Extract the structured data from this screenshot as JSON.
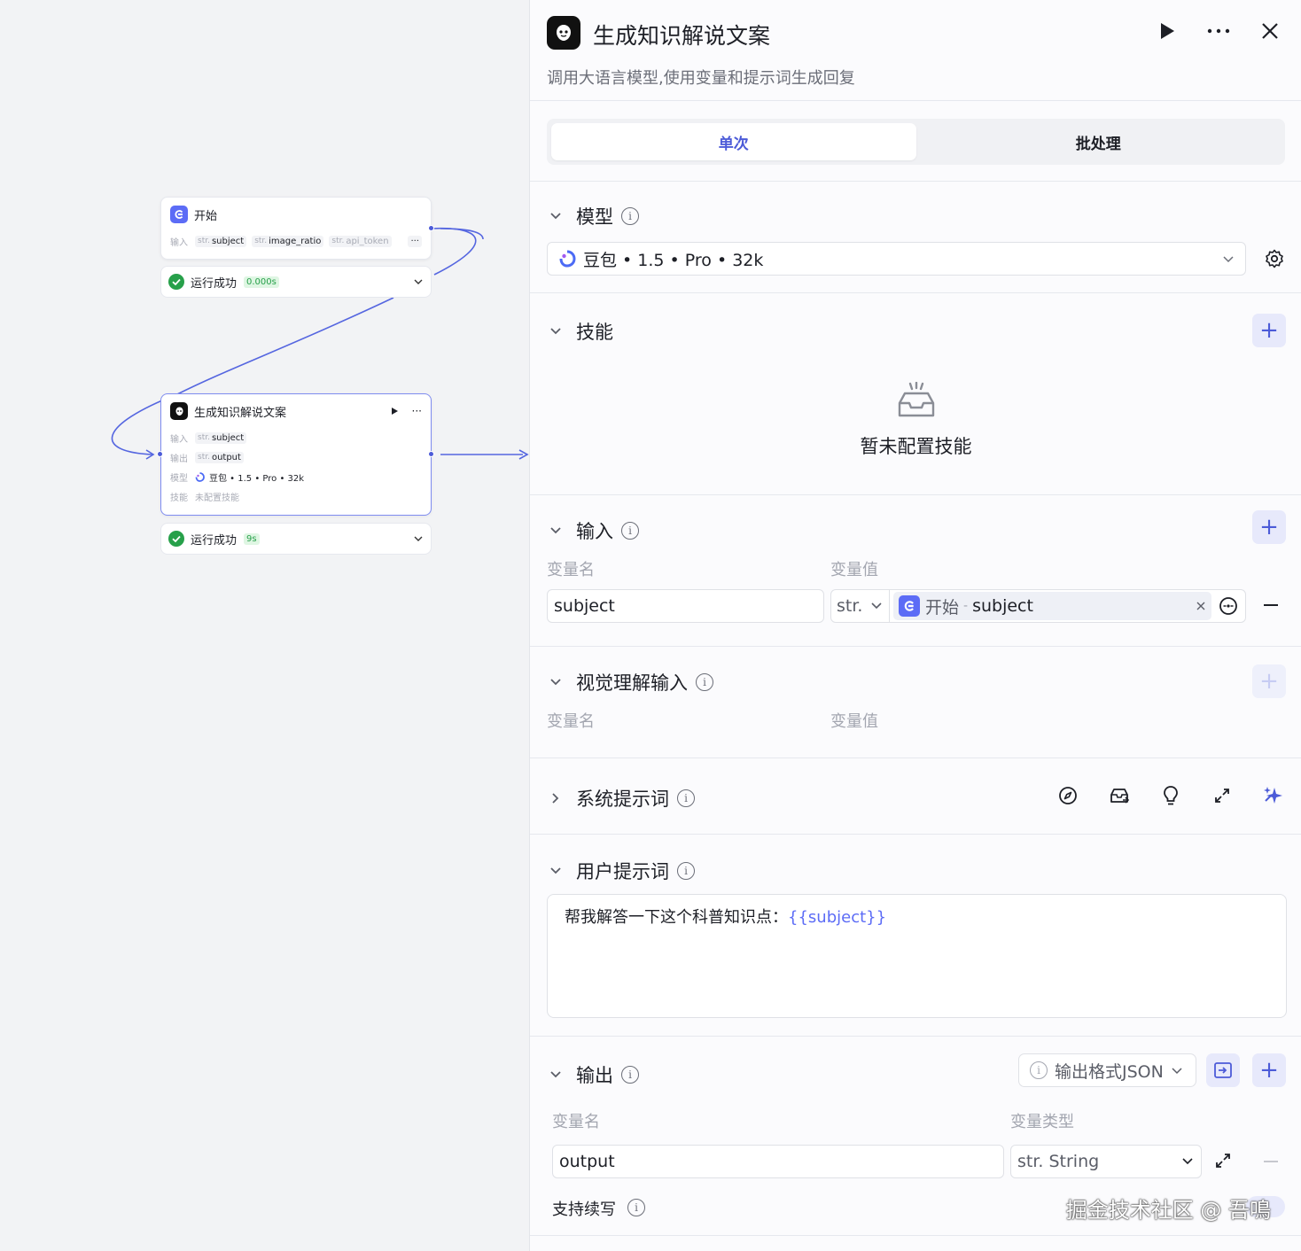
{
  "canvas": {
    "start_node": {
      "title": "开始",
      "input_label": "输入",
      "inputs": [
        {
          "type": "str.",
          "name": "subject"
        },
        {
          "type": "str.",
          "name": "image_ratio"
        },
        {
          "type": "str.",
          "name": "api_token"
        }
      ],
      "more": "···",
      "status": "运行成功",
      "time": "0.000s"
    },
    "llm_node": {
      "title": "生成知识解说文案",
      "more": "···",
      "input_label": "输入",
      "input_chip": {
        "type": "str.",
        "name": "subject"
      },
      "output_label": "输出",
      "output_chip": {
        "type": "str.",
        "name": "output"
      },
      "model_label": "模型",
      "model_value": "豆包 • 1.5 • Pro • 32k",
      "skill_label": "技能",
      "skill_value": "未配置技能",
      "status": "运行成功",
      "time": "9s"
    }
  },
  "panel": {
    "title": "生成知识解说文案",
    "description": "调用大语言模型,使用变量和提示词生成回复",
    "tabs": [
      {
        "label": "单次",
        "active": true
      },
      {
        "label": "批处理",
        "active": false
      }
    ],
    "model": {
      "title": "模型",
      "value": "豆包 • 1.5 • Pro • 32k"
    },
    "skills": {
      "title": "技能",
      "empty_text": "暂未配置技能"
    },
    "input": {
      "title": "输入",
      "col_name": "变量名",
      "col_value": "变量值",
      "row": {
        "name": "subject",
        "type": "str.",
        "ref_node": "开始",
        "ref_sep": "-",
        "ref_var": "subject"
      }
    },
    "vision_input": {
      "title": "视觉理解输入",
      "col_name": "变量名",
      "col_value": "变量值"
    },
    "system_prompt": {
      "title": "系统提示词"
    },
    "user_prompt": {
      "title": "用户提示词",
      "text": "帮我解答一下这个科普知识点：",
      "variable": "{{subject}}"
    },
    "output": {
      "title": "输出",
      "format_label": "输出格式JSON",
      "col_name": "变量名",
      "col_type": "变量类型",
      "row": {
        "name": "output",
        "type_prefix": "str.",
        "type": "String"
      },
      "streaming_label": "支持续写"
    },
    "watermark": "掘金技术社区 @ 吾鳴"
  },
  "colors": {
    "accent": "#4c5bd8",
    "success": "#27a04a",
    "start_icon": "#5c6cf6"
  }
}
